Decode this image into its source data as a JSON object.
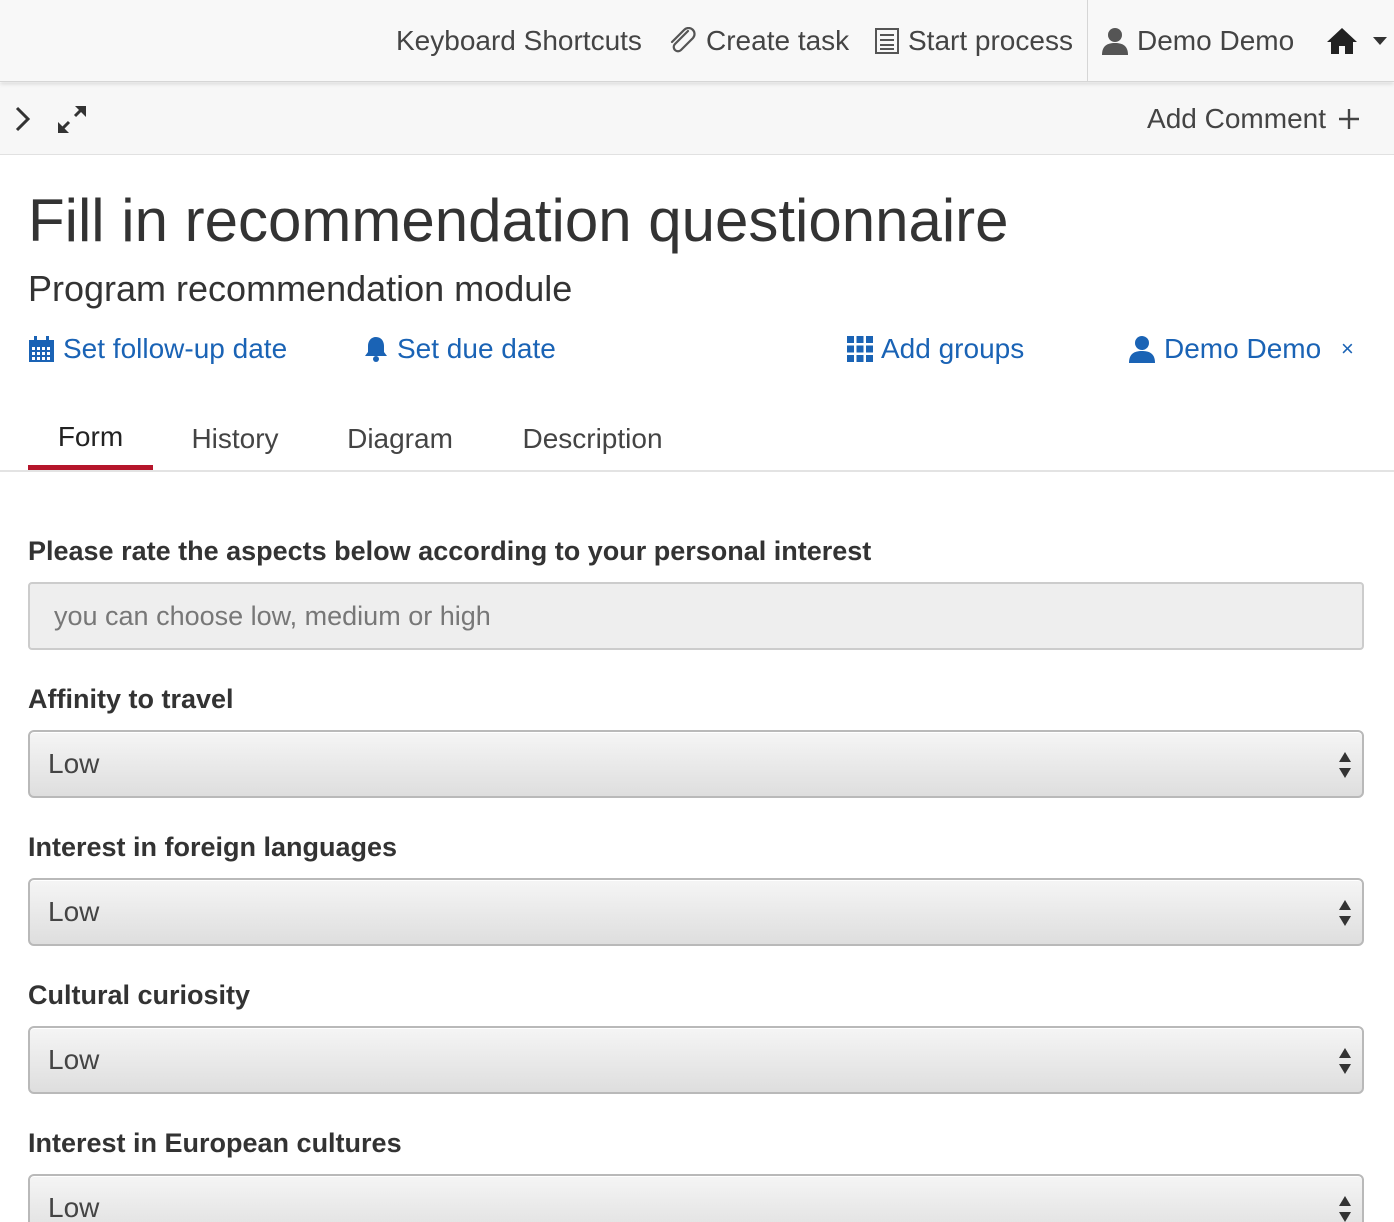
{
  "navbar": {
    "keyboard_shortcuts": "Keyboard Shortcuts",
    "create_task": "Create task",
    "start_process": "Start process",
    "user": "Demo Demo"
  },
  "toolbar": {
    "add_comment": "Add Comment"
  },
  "task": {
    "title": "Fill in recommendation questionnaire",
    "subtitle": "Program recommendation module",
    "actions": {
      "follow_up": "Set follow-up date",
      "due_date": "Set due date",
      "groups": "Add groups",
      "assignee": "Demo Demo",
      "remove": "×"
    }
  },
  "tabs": [
    {
      "label": "Form",
      "active": true
    },
    {
      "label": "History",
      "active": false
    },
    {
      "label": "Diagram",
      "active": false
    },
    {
      "label": "Description",
      "active": false
    }
  ],
  "form": {
    "intro_label": "Please rate the aspects below according to your personal interest",
    "intro_value": "you can choose low, medium or high",
    "fields": [
      {
        "label": "Affinity to travel",
        "value": "Low"
      },
      {
        "label": "Interest in foreign languages",
        "value": "Low"
      },
      {
        "label": "Cultural curiosity",
        "value": "Low"
      },
      {
        "label": "Interest in European cultures",
        "value": "Low"
      }
    ]
  },
  "colors": {
    "link": "#1a63b5",
    "active_tab": "#b5152b"
  }
}
